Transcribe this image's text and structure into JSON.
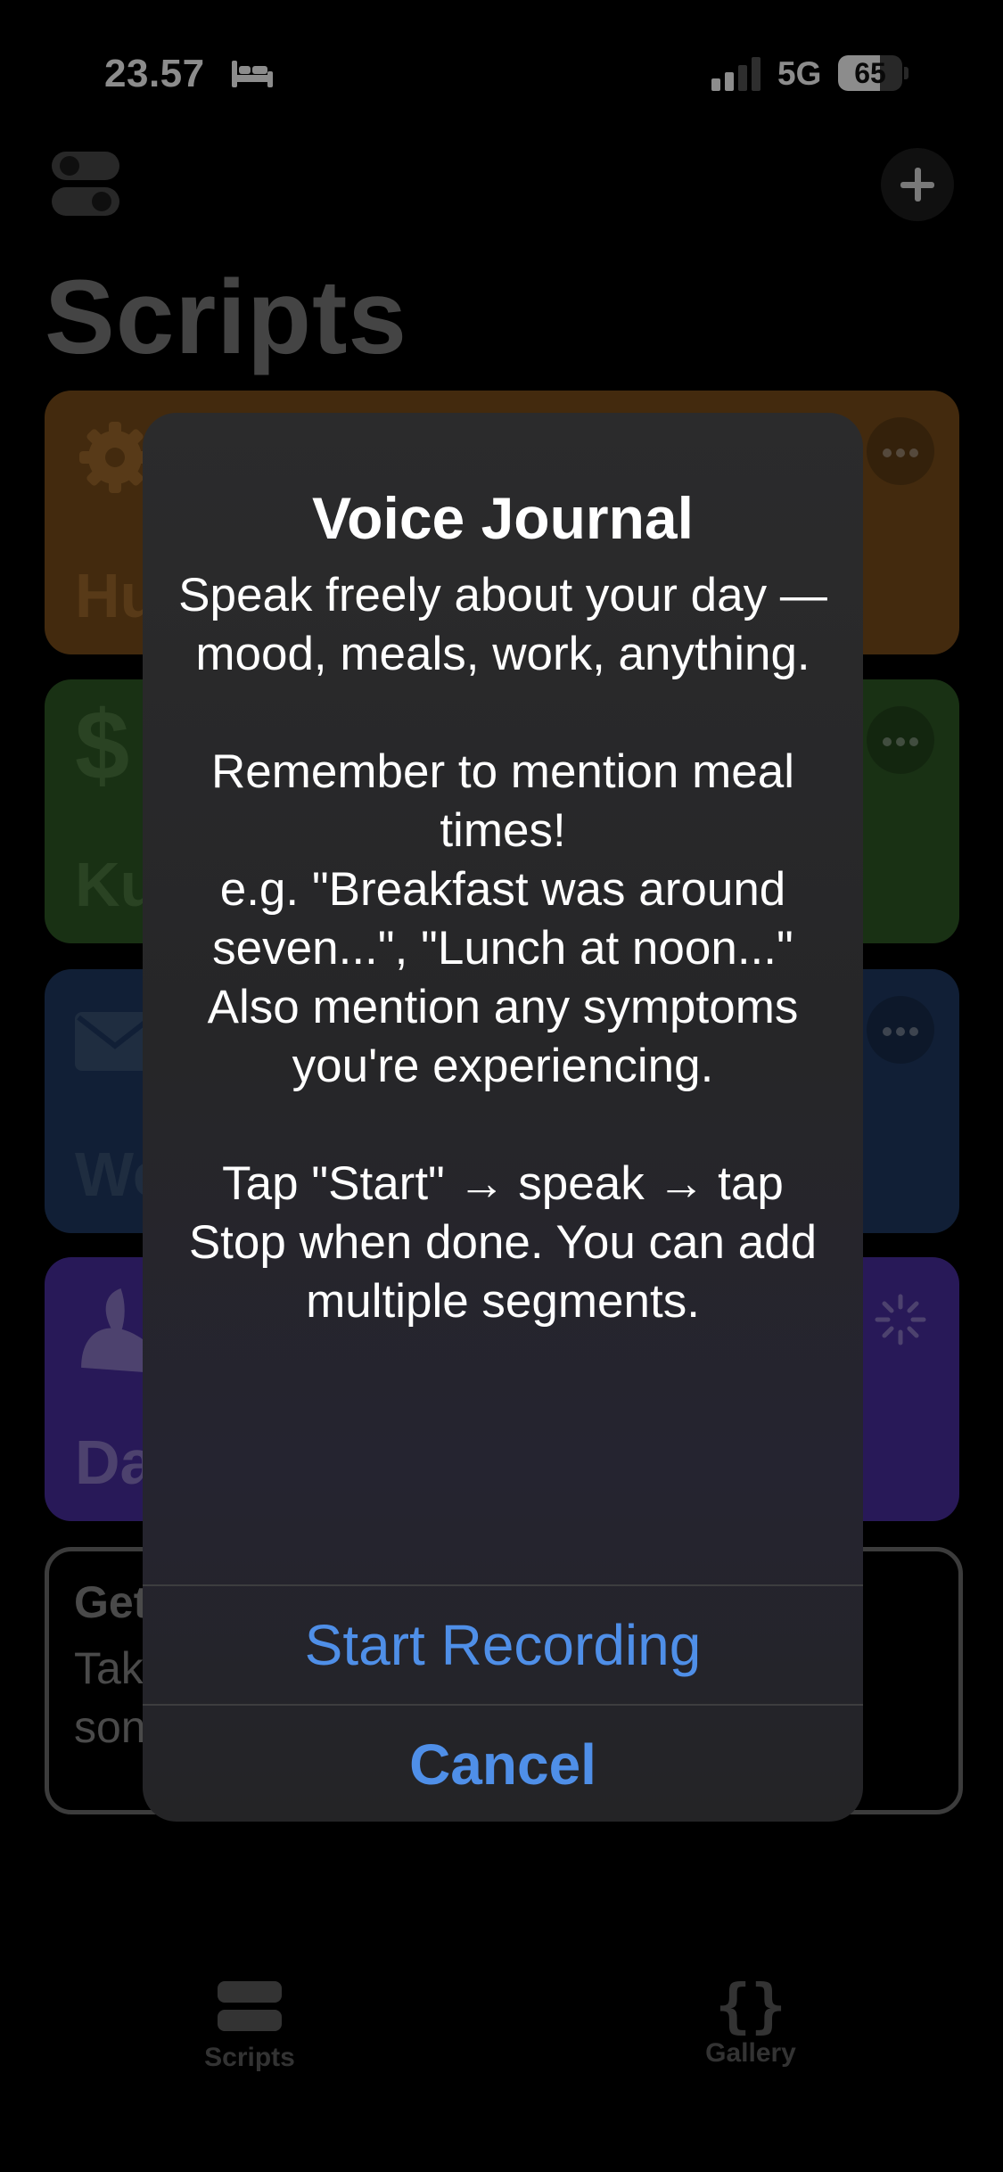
{
  "status_bar": {
    "time": "23.57",
    "network": "5G",
    "battery_percent": 65,
    "battery_label": "65"
  },
  "header": {
    "title": "Scripts"
  },
  "cards": [
    {
      "label": "Hu",
      "color": "#7a4e1a",
      "icon": "gear-icon"
    },
    {
      "label": "Ku",
      "color": "#2f5a26",
      "icon": "dollar-icon"
    },
    {
      "label": "We",
      "color": "#1f3a63",
      "icon": "mail-icon"
    },
    {
      "label": "Da",
      "color": "#4a2ea0",
      "icon": "bird-icon"
    }
  ],
  "get_started": {
    "title": "Get",
    "body_line1": "Tak",
    "body_line2": "son"
  },
  "tab_bar": {
    "tabs": [
      {
        "label": "Scripts",
        "icon": "stack-icon"
      },
      {
        "label": "Gallery",
        "icon": "braces-icon"
      }
    ]
  },
  "dialog": {
    "title": "Voice Journal",
    "message": {
      "p1": "Speak freely about your day — mood, meals, work, anything.",
      "p2": "Remember to mention meal times!",
      "p3": "e.g. \"Breakfast was around seven...\", \"Lunch at noon...\"",
      "p4": "Also mention any symptoms you're experiencing.",
      "p5": "Tap \"Start\" → speak → tap Stop when done. You can add multiple segments."
    },
    "primary_button": "Start Recording",
    "cancel_button": "Cancel",
    "accent_color": "#4f8fe8"
  }
}
